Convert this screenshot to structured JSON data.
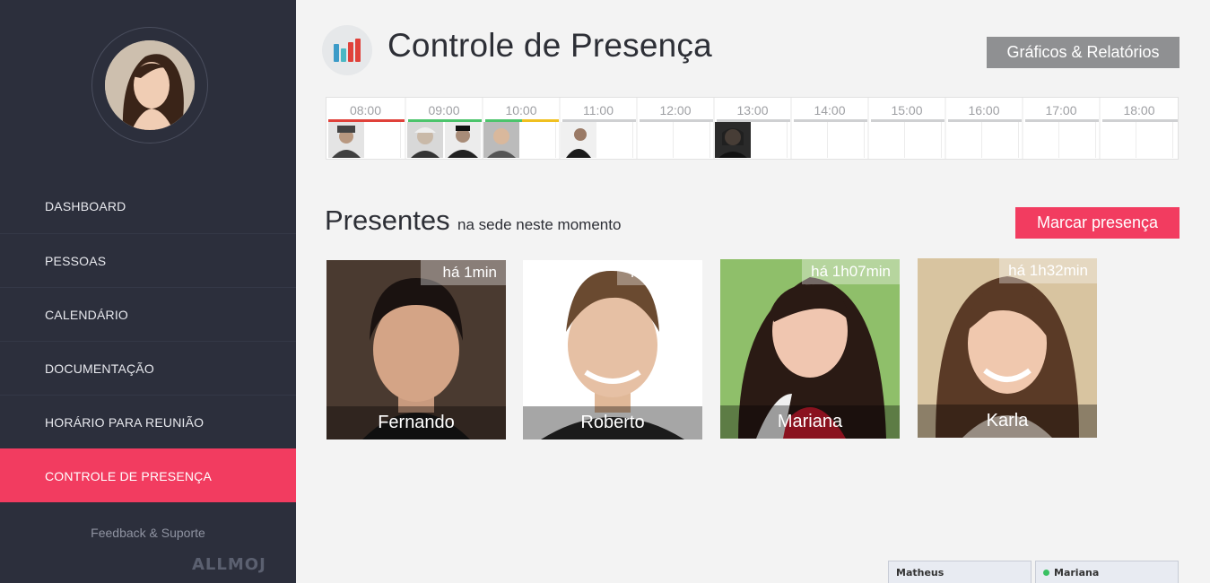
{
  "app": {
    "title": "Controle de Presença",
    "reports_button": "Gráficos & Relatórios"
  },
  "sidebar": {
    "items": [
      {
        "label": "DASHBOARD"
      },
      {
        "label": "PESSOAS"
      },
      {
        "label": "CALENDÁRIO"
      },
      {
        "label": "DOCUMENTAÇÃO"
      },
      {
        "label": "HORÁRIO PARA REUNIÃO"
      },
      {
        "label": "CONTROLE DE PRESENÇA",
        "active": true
      }
    ],
    "feedback": "Feedback & Suporte",
    "logo": "ALLMOJ"
  },
  "timeline": {
    "hours": [
      "08:00",
      "09:00",
      "10:00",
      "11:00",
      "12:00",
      "13:00",
      "14:00",
      "15:00",
      "16:00",
      "17:00",
      "18:00"
    ]
  },
  "presentes": {
    "title": "Presentes",
    "subtitle": "na sede neste momento",
    "mark_button": "Marcar presença",
    "people": [
      {
        "name": "Fernando",
        "time": "há 1min"
      },
      {
        "name": "Roberto",
        "time": "há 43min"
      },
      {
        "name": "Mariana",
        "time": "há 1h07min"
      },
      {
        "name": "Karla",
        "time": "há 1h32min"
      }
    ]
  },
  "chat": {
    "tabs": [
      {
        "name": "Matheus",
        "online": false
      },
      {
        "name": "Mariana",
        "online": true
      }
    ]
  },
  "colors": {
    "accent": "#f23c60",
    "sidebar_bg": "#2c2f3c",
    "late": "#e0413a",
    "on_time": "#4cc46c",
    "warning": "#f0c020"
  }
}
